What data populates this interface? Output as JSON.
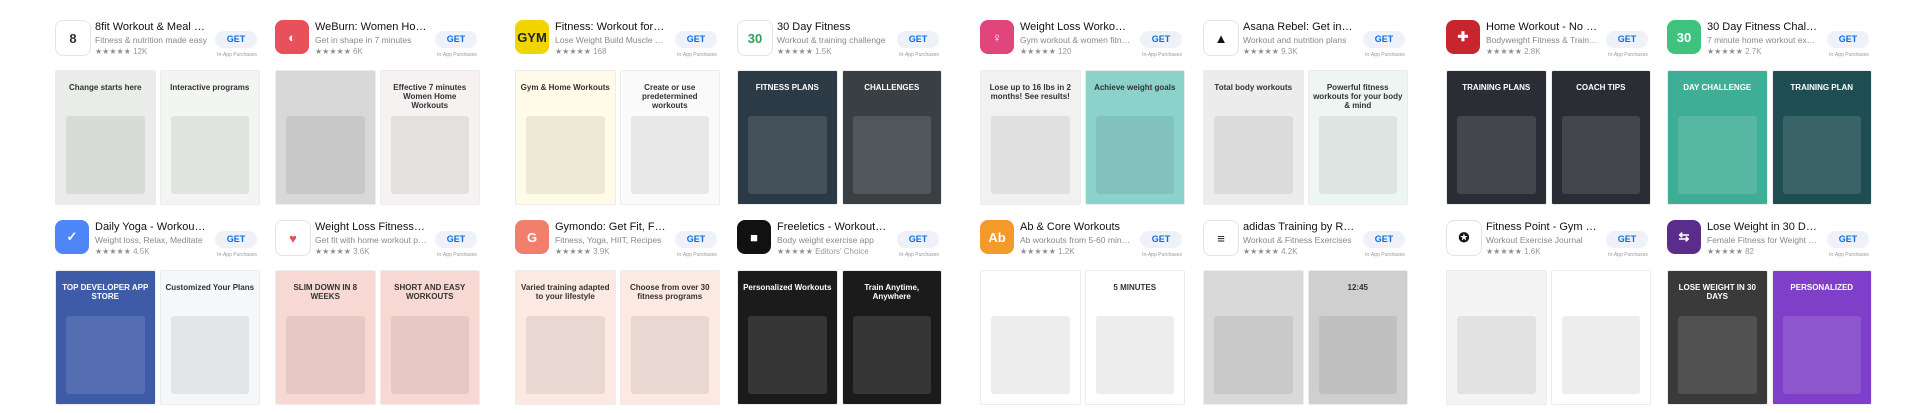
{
  "apps": [
    {
      "title": "8fit Workout & Meal Plann...",
      "subtitle": "Fitness & nutrition made easy",
      "rating_count": "12K",
      "get": "GET",
      "iap": "In-App Purchases",
      "icon_glyph": "8",
      "icon_bg": "#ffffff",
      "icon_fg": "#333333",
      "icon": "8fit-logo-icon",
      "shot_captions": [
        "Change starts here",
        "Interactive programs"
      ],
      "shot_colors": [
        "#e9ece8",
        "#f3f5f3"
      ]
    },
    {
      "title": "WeBurn: Women Home W...",
      "subtitle": "Get in shape in 7 minutes",
      "rating_count": "6K",
      "get": "GET",
      "iap": "In-App Purchases",
      "icon_glyph": "◐",
      "icon_bg": "#e8505b",
      "icon_fg": "#ffffff",
      "icon": "flame-icon",
      "shot_captions": [
        "",
        "Effective 7 minutes Women Home Workouts"
      ],
      "shot_colors": [
        "#d8d8d8",
        "#f7f2f2"
      ]
    },
    {
      "title": "Fitness: Workout for Gym|...",
      "subtitle": "Lose Weight Build Muscle Toned",
      "rating_count": "168",
      "get": "GET",
      "iap": "In-App Purchases",
      "icon_glyph": "GYM",
      "icon_bg": "#f2d400",
      "icon_fg": "#222222",
      "icon": "gym-figure-icon",
      "shot_captions": [
        "Gym & Home Workouts",
        "Create or use predetermined workouts"
      ],
      "shot_colors": [
        "#fffbe8",
        "#fafafa"
      ]
    },
    {
      "title": "30 Day Fitness",
      "subtitle": "Workout & training challenge",
      "rating_count": "1.5K",
      "get": "GET",
      "iap": "In-App Purchases",
      "icon_glyph": "30",
      "icon_bg": "#ffffff",
      "icon_fg": "#2f9e5b",
      "icon": "30-day-badge-icon",
      "shot_captions": [
        "FITNESS PLANS",
        "CHALLENGES"
      ],
      "shot_colors": [
        "#2b3a44",
        "#3a3f44"
      ]
    },
    {
      "title": "Weight Loss Workouts for...",
      "subtitle": "Gym workout & women fitness",
      "rating_count": "120",
      "get": "GET",
      "iap": "In-App Purchases",
      "icon_glyph": "♀",
      "icon_bg": "#e0457b",
      "icon_fg": "#ffffff",
      "icon": "woman-fitness-icon",
      "shot_captions": [
        "Lose up to 16 lbs in 2 months! See results!",
        "Achieve weight goals"
      ],
      "shot_colors": [
        "#f1f1f1",
        "#8bd2cb"
      ]
    },
    {
      "title": "Asana Rebel: Get in Shape",
      "subtitle": "Workout and nutrition plans",
      "rating_count": "9.3K",
      "get": "GET",
      "iap": "In-App Purchases",
      "icon_glyph": "▲",
      "icon_bg": "#ffffff",
      "icon_fg": "#111111",
      "icon": "asana-triangle-icon",
      "shot_captions": [
        "Total body workouts",
        "Powerful fitness workouts for your body & mind"
      ],
      "shot_colors": [
        "#ececec",
        "#eef6f3"
      ]
    },
    {
      "title": "Home Workout - No Equi...",
      "subtitle": "Bodyweight Fitness & Training",
      "rating_count": "2.8K",
      "get": "GET",
      "iap": "In-App Purchases",
      "icon_glyph": "✚",
      "icon_bg": "#c8262e",
      "icon_fg": "#ffffff",
      "icon": "muscle-man-icon",
      "shot_captions": [
        "TRAINING PLANS",
        "COACH TIPS"
      ],
      "shot_colors": [
        "#2a2d33",
        "#2a2d33"
      ]
    },
    {
      "title": "30 Day Fitness Challenge...",
      "subtitle": "7 minute home workout exercise",
      "rating_count": "2.7K",
      "get": "GET",
      "iap": "In-App Purchases",
      "icon_glyph": "30",
      "icon_bg": "#3fc27d",
      "icon_fg": "#ffffff",
      "icon": "30-day-challenge-icon",
      "shot_captions": [
        "DAY CHALLENGE",
        "TRAINING PLAN"
      ],
      "shot_colors": [
        "#3fae96",
        "#1f4e52"
      ]
    },
    {
      "title": "Daily Yoga - Workout & Fi...",
      "subtitle": "Weight loss, Relax, Meditate",
      "rating_count": "4.5K",
      "get": "GET",
      "iap": "In-App Purchases",
      "icon_glyph": "✓",
      "icon_bg": "#4f86f7",
      "icon_fg": "#ffffff",
      "icon": "yoga-pose-icon",
      "shot_captions": [
        "TOP DEVELOPER APP STORE",
        "Customized Your Plans"
      ],
      "shot_colors": [
        "#3e5ba8",
        "#f5f7fb"
      ]
    },
    {
      "title": "Weight Loss Fitness by Ve...",
      "subtitle": "Get fit with home workout plan",
      "rating_count": "3.6K",
      "get": "GET",
      "iap": "In-App Purchases",
      "icon_glyph": "♥",
      "icon_bg": "#ffffff",
      "icon_fg": "#e8505b",
      "icon": "heart-icon",
      "shot_captions": [
        "SLIM DOWN IN 8 WEEKS",
        "SHORT AND EASY WORKOUTS"
      ],
      "shot_colors": [
        "#f8d8d3",
        "#f8d8d3"
      ]
    },
    {
      "title": "Gymondo: Get Fit, Feel H...",
      "subtitle": "Fitness, Yoga, HIIT, Recipes",
      "rating_count": "3.9K",
      "get": "GET",
      "iap": "In-App Purchases",
      "icon_glyph": "G",
      "icon_bg": "#f0806c",
      "icon_fg": "#ffffff",
      "icon": "gymondo-g-icon",
      "shot_captions": [
        "Varied training adapted to your lifestyle",
        "Choose from over 30 fitness programs"
      ],
      "shot_colors": [
        "#fbe9e2",
        "#fbe9e2"
      ]
    },
    {
      "title": "Freeletics - Workout & Fit...",
      "subtitle": "Body weight exercise app",
      "rating_count": "Editors' Choice",
      "get": "GET",
      "iap": "In-App Purchases",
      "icon_glyph": "■",
      "icon_bg": "#111111",
      "icon_fg": "#ffffff",
      "icon": "freeletics-icon",
      "shot_captions": [
        "Personalized Workouts",
        "Train Anytime, Anywhere"
      ],
      "shot_colors": [
        "#1b1b1b",
        "#1b1b1b"
      ]
    },
    {
      "title": "Ab & Core Workouts",
      "subtitle": "Ab workouts from 5-60 minutes",
      "rating_count": "1.2K",
      "get": "GET",
      "iap": "In-App Purchases",
      "icon_glyph": "Ab",
      "icon_bg": "#f39a2a",
      "icon_fg": "#ffffff",
      "icon": "ab-workout-icon",
      "shot_captions": [
        "",
        "5 MINUTES"
      ],
      "shot_colors": [
        "#ffffff",
        "#ffffff"
      ]
    },
    {
      "title": "adidas Training by Runtas...",
      "subtitle": "Workout & Fitness Exercises",
      "rating_count": "4.2K",
      "get": "GET",
      "iap": "In-App Purchases",
      "icon_glyph": "≡",
      "icon_bg": "#ffffff",
      "icon_fg": "#1a1a1a",
      "icon": "adidas-logo-icon",
      "shot_captions": [
        "",
        "12:45"
      ],
      "shot_colors": [
        "#d9d9d9",
        "#cfcfcf"
      ]
    },
    {
      "title": "Fitness Point - Gym Buddy",
      "subtitle": "Workout Exercise Journal",
      "rating_count": "1.6K",
      "get": "GET",
      "iap": "In-App Purchases",
      "icon_glyph": "✪",
      "icon_bg": "#ffffff",
      "icon_fg": "#111111",
      "icon": "dumbbell-man-icon",
      "shot_captions": [
        "",
        ""
      ],
      "shot_colors": [
        "#f4f4f4",
        "#ffffff"
      ]
    },
    {
      "title": "Lose Weight in 30 Days",
      "subtitle": "Female Fitness for Weight Loss",
      "rating_count": "82",
      "get": "GET",
      "iap": "In-App Purchases",
      "icon_glyph": "⇆",
      "icon_bg": "#5a2d8c",
      "icon_fg": "#ffffff",
      "icon": "lose-weight-icon",
      "shot_captions": [
        "LOSE WEIGHT IN 30 DAYS",
        "PERSONALIZED"
      ],
      "shot_colors": [
        "#3a3a3a",
        "#7f3fc8"
      ]
    }
  ],
  "stars_glyph": "★★★★★"
}
